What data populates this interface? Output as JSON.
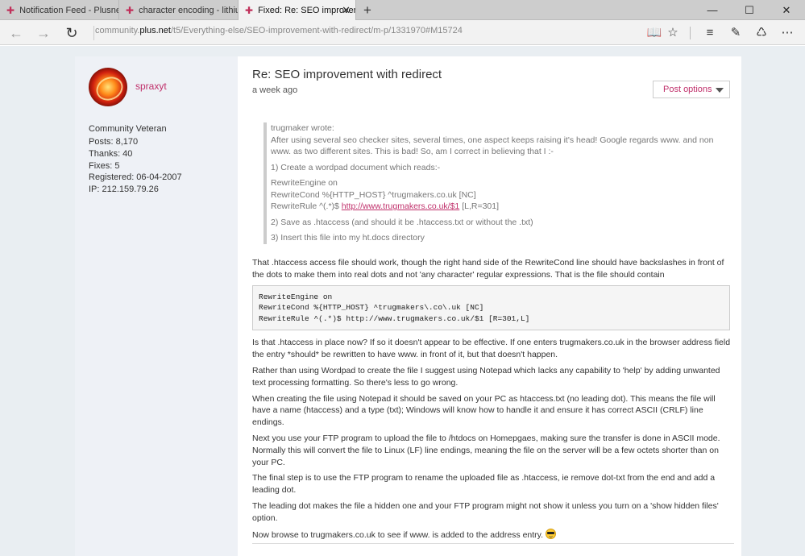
{
  "tabs": [
    {
      "title": "Notification Feed - Plusnet C"
    },
    {
      "title": "character encoding - lithium"
    },
    {
      "title": "Fixed: Re: SEO improven"
    }
  ],
  "address": {
    "prefix": "community.",
    "domain": "plus.net",
    "path": "/t5/Everything-else/SEO-improvement-with-redirect/m-p/1331970#M15724"
  },
  "author": {
    "name": "spraxyt",
    "rank": "Community Veteran",
    "stats": [
      "Posts: 8,170",
      "Thanks: 40",
      "Fixes: 5",
      "Registered: 06-04-2007",
      "IP: 212.159.79.26"
    ]
  },
  "post": {
    "title": "Re: SEO improvement with redirect",
    "date": "a week ago",
    "options_label": "Post options",
    "quote": {
      "author_line": "trugmaker wrote:",
      "intro": "After using several seo checker sites, several times, one aspect keeps raising it's head! Google regards www. and non www. as two different sites. This is bad! So, am I correct in believing that I :-",
      "step1": "1) Create a wordpad document which reads:-",
      "code_line1": "RewriteEngine on",
      "code_line2": "RewriteCond %{HTTP_HOST} ^trugmakers.co.uk [NC]",
      "code_line3_pre": "RewriteRule ^(.*)$ ",
      "code_line3_link": "http://www.trugmakers.co.uk/$1",
      "code_line3_post": " [L,R=301]",
      "step2": "2) Save as .htaccess  (and should it be .htaccess.txt or without the .txt)",
      "step3": "3) Insert this file into my ht.docs directory"
    },
    "para1": "That .htaccess access file should work, though the right hand side of the RewriteCond line should have backslashes in front of the dots to make them into real dots and not 'any character' regular expressions. That is the file should contain",
    "code": "RewriteEngine on\nRewriteCond %{HTTP_HOST} ^trugmakers\\.co\\.uk [NC]\nRewriteRule ^(.*)$ http://www.trugmakers.co.uk/$1 [R=301,L]",
    "para2": "Is that .htaccess in place now? If so it doesn't appear to be effective. If one enters trugmakers.co.uk in the browser address field the entry *should* be rewritten to have www. in front of it, but that doesn't happen.",
    "para3": "Rather than using Wordpad to create the file I suggest using Notepad which lacks any capability to 'help' by adding unwanted text processing formatting. So there's less to go wrong.",
    "para4": "When creating the file using Notepad it should be saved on your PC as htaccess.txt (no leading dot). This means the file will have a name (htaccess) and a type (txt); Windows will know how to handle it and ensure it has correct ASCII (CRLF) line endings.",
    "para5": "Next you use your FTP program to upload the file to /htdocs on Homepgaes, making sure the transfer is done in ASCII mode. Normally this will convert the file to Linux (LF) line endings, meaning the file on the server will be a few octets shorter than on your PC.",
    "para6": "The final step is to use the FTP program to rename the uploaded file as .htaccess, ie remove dot-txt from the end and add a leading dot.",
    "para7": "The leading dot makes the file a hidden one and your FTP program might not show it unless you turn on a 'show hidden files' option.",
    "para8": "Now browse to trugmakers.co.uk to see if www. is added to the address entry."
  },
  "colors": {
    "accent": "#c0306b",
    "page_bg": "#e9eef2",
    "sidebar_bg": "#eef1f6"
  }
}
